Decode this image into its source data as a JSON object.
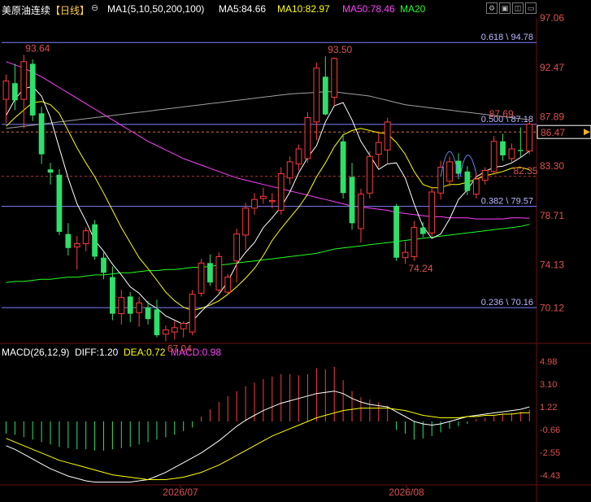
{
  "header": {
    "instrument": "美原油连续",
    "period_tag": "【日线】",
    "indicator_name": "MA1(5,10,50,200,100)",
    "ma5": "MA5:84.66",
    "ma10": "MA10:82.97",
    "ma50": "MA50:78.46",
    "ma20": "MA20",
    "colors": {
      "ma5": "#ffffff",
      "ma10": "#ffff00",
      "ma50": "#ff40ff",
      "ma20": "#20ff20"
    }
  },
  "toolbar": {
    "icons": [
      "gear-icon",
      "layout-icon",
      "panel-icon",
      "expand-icon"
    ]
  },
  "macd_header": {
    "name": "MACD(26,12,9)",
    "diff": "DIFF:1.20",
    "dea": "DEA:0.72",
    "macd": "MACD:0.98"
  },
  "price_axis": {
    "ticks": [
      "97.06",
      "92.47",
      "87.89",
      "83.30",
      "78.71",
      "74.13",
      "70.12"
    ],
    "current": "86.47"
  },
  "macd_axis": {
    "ticks": [
      "4.98",
      "3.10",
      "1.22",
      "-0.66",
      "-2.55",
      "-4.43"
    ]
  },
  "fib_levels": [
    {
      "ratio_label": "0.618 \\ 94.78",
      "price": 94.78
    },
    {
      "ratio_label": "0.500 \\ 87.18",
      "price": 87.18
    },
    {
      "ratio_label": "0.382 \\ 79.57",
      "price": 79.57
    },
    {
      "ratio_label": "0.236 \\ 70.16",
      "price": 70.16
    }
  ],
  "annotations": {
    "high1": "93.64",
    "high2": "93.50",
    "low1": "67.04",
    "low2": "74.24",
    "ref1": "87.69",
    "ref2": "82.35"
  },
  "x_axis": {
    "labels": [
      "2026/07",
      "2026/08"
    ]
  },
  "chart_data": {
    "type": "candlestick",
    "y_range": [
      67.0,
      97.06
    ],
    "candles": [
      {
        "o": 89.5,
        "h": 91.8,
        "l": 87.3,
        "c": 91.2
      },
      {
        "o": 91.0,
        "h": 92.8,
        "l": 88.5,
        "c": 89.4
      },
      {
        "o": 89.5,
        "h": 93.64,
        "l": 86.8,
        "c": 93.0
      },
      {
        "o": 92.8,
        "h": 93.2,
        "l": 87.5,
        "c": 88.0
      },
      {
        "o": 88.2,
        "h": 88.8,
        "l": 83.5,
        "c": 84.4
      },
      {
        "o": 83.0,
        "h": 83.6,
        "l": 81.6,
        "c": 82.7
      },
      {
        "o": 82.5,
        "h": 83.0,
        "l": 76.9,
        "c": 77.2
      },
      {
        "o": 77.0,
        "h": 78.0,
        "l": 75.0,
        "c": 75.7
      },
      {
        "o": 75.8,
        "h": 76.8,
        "l": 73.7,
        "c": 76.1
      },
      {
        "o": 76.1,
        "h": 77.6,
        "l": 75.4,
        "c": 77.3
      },
      {
        "o": 77.9,
        "h": 78.3,
        "l": 74.6,
        "c": 74.9
      },
      {
        "o": 74.8,
        "h": 75.3,
        "l": 72.8,
        "c": 73.4
      },
      {
        "o": 73.0,
        "h": 74.0,
        "l": 69.0,
        "c": 69.6
      },
      {
        "o": 69.6,
        "h": 71.8,
        "l": 68.6,
        "c": 71.1
      },
      {
        "o": 71.2,
        "h": 71.6,
        "l": 68.8,
        "c": 69.6
      },
      {
        "o": 69.7,
        "h": 71.2,
        "l": 68.4,
        "c": 70.6
      },
      {
        "o": 70.2,
        "h": 70.8,
        "l": 68.6,
        "c": 69.1
      },
      {
        "o": 70.0,
        "h": 70.9,
        "l": 67.4,
        "c": 67.6
      },
      {
        "o": 67.7,
        "h": 68.5,
        "l": 67.04,
        "c": 68.1
      },
      {
        "o": 67.9,
        "h": 68.9,
        "l": 67.2,
        "c": 68.3
      },
      {
        "o": 68.2,
        "h": 68.9,
        "l": 67.4,
        "c": 68.7
      },
      {
        "o": 67.9,
        "h": 71.8,
        "l": 67.6,
        "c": 71.4
      },
      {
        "o": 71.5,
        "h": 74.7,
        "l": 71.2,
        "c": 74.3
      },
      {
        "o": 74.3,
        "h": 75.1,
        "l": 72.2,
        "c": 72.5
      },
      {
        "o": 71.8,
        "h": 75.3,
        "l": 71.4,
        "c": 74.9
      },
      {
        "o": 71.6,
        "h": 73.3,
        "l": 71.4,
        "c": 73.0
      },
      {
        "o": 74.5,
        "h": 77.5,
        "l": 72.5,
        "c": 77.0
      },
      {
        "o": 76.9,
        "h": 79.9,
        "l": 75.5,
        "c": 79.4
      },
      {
        "o": 79.4,
        "h": 80.8,
        "l": 78.8,
        "c": 80.2
      },
      {
        "o": 80.3,
        "h": 81.3,
        "l": 79.8,
        "c": 80.5
      },
      {
        "o": 80.0,
        "h": 80.8,
        "l": 79.4,
        "c": 80.1
      },
      {
        "o": 79.2,
        "h": 83.2,
        "l": 78.8,
        "c": 82.6
      },
      {
        "o": 82.2,
        "h": 84.2,
        "l": 81.6,
        "c": 83.7
      },
      {
        "o": 83.5,
        "h": 85.3,
        "l": 82.9,
        "c": 84.9
      },
      {
        "o": 84.0,
        "h": 88.3,
        "l": 83.6,
        "c": 87.8
      },
      {
        "o": 87.4,
        "h": 92.9,
        "l": 85.7,
        "c": 92.4
      },
      {
        "o": 91.6,
        "h": 93.5,
        "l": 88.0,
        "c": 88.1
      },
      {
        "o": 89.7,
        "h": 93.4,
        "l": 88.9,
        "c": 93.3
      },
      {
        "o": 85.6,
        "h": 86.3,
        "l": 80.3,
        "c": 80.8
      },
      {
        "o": 82.3,
        "h": 83.6,
        "l": 77.4,
        "c": 78.0
      },
      {
        "o": 77.5,
        "h": 81.2,
        "l": 76.2,
        "c": 80.7
      },
      {
        "o": 80.8,
        "h": 84.7,
        "l": 80.3,
        "c": 84.2
      },
      {
        "o": 84.4,
        "h": 86.5,
        "l": 83.2,
        "c": 85.5
      },
      {
        "o": 84.8,
        "h": 87.8,
        "l": 83.5,
        "c": 87.4
      },
      {
        "o": 79.6,
        "h": 79.8,
        "l": 74.5,
        "c": 74.8
      },
      {
        "o": 74.8,
        "h": 76.3,
        "l": 74.24,
        "c": 75.3
      },
      {
        "o": 74.9,
        "h": 78.2,
        "l": 74.5,
        "c": 77.6
      },
      {
        "o": 77.6,
        "h": 78.1,
        "l": 76.7,
        "c": 77.0
      },
      {
        "o": 77.1,
        "h": 81.4,
        "l": 76.8,
        "c": 80.9
      },
      {
        "o": 80.8,
        "h": 83.8,
        "l": 80.2,
        "c": 83.2
      },
      {
        "o": 81.9,
        "h": 84.2,
        "l": 81.4,
        "c": 83.7
      },
      {
        "o": 83.8,
        "h": 84.5,
        "l": 82.1,
        "c": 82.6
      },
      {
        "o": 82.8,
        "h": 83.3,
        "l": 80.6,
        "c": 81.0
      },
      {
        "o": 80.7,
        "h": 82.6,
        "l": 80.3,
        "c": 82.1
      },
      {
        "o": 82.0,
        "h": 83.2,
        "l": 81.6,
        "c": 82.9
      },
      {
        "o": 82.8,
        "h": 86.1,
        "l": 82.5,
        "c": 85.6
      },
      {
        "o": 85.6,
        "h": 86.3,
        "l": 83.8,
        "c": 84.3
      },
      {
        "o": 84.0,
        "h": 85.4,
        "l": 83.7,
        "c": 84.9
      },
      {
        "o": 84.8,
        "h": 86.9,
        "l": 84.1,
        "c": 84.7
      },
      {
        "o": 84.7,
        "h": 87.69,
        "l": 84.4,
        "c": 87.2
      }
    ],
    "ma": {
      "ma5": [
        88.0,
        89.5,
        90.5,
        90.7,
        89.8,
        87.8,
        85.0,
        82.2,
        79.8,
        78.2,
        76.4,
        75.4,
        74.2,
        73.2,
        72.1,
        71.5,
        70.6,
        70.1,
        69.4,
        69.0,
        68.6,
        68.9,
        69.8,
        70.6,
        71.4,
        72.6,
        74.2,
        75.3,
        76.2,
        77.6,
        78.5,
        79.5,
        80.9,
        82.7,
        84.1,
        85.2,
        87.4,
        88.9,
        89.2,
        87.6,
        85.6,
        84.3,
        83.0,
        83.5,
        83.6,
        82.2,
        79.8,
        77.7,
        76.6,
        77.0,
        78.4,
        80.2,
        81.1,
        82.3,
        82.8,
        83.2,
        83.3,
        83.6,
        84.1,
        84.7
      ],
      "ma10": [
        87.0,
        87.8,
        88.5,
        89.2,
        89.3,
        89.0,
        88.2,
        86.6,
        85.0,
        83.6,
        82.3,
        80.8,
        79.2,
        77.6,
        76.2,
        74.8,
        73.8,
        72.7,
        71.6,
        70.8,
        70.2,
        69.9,
        70.1,
        70.4,
        70.8,
        71.4,
        72.1,
        72.9,
        73.8,
        75.0,
        76.4,
        77.5,
        78.5,
        79.5,
        80.7,
        82.3,
        83.6,
        85.1,
        86.2,
        86.6,
        86.8,
        86.6,
        86.4,
        86.3,
        85.5,
        84.4,
        82.8,
        81.6,
        81.3,
        81.3,
        81.6,
        81.6,
        81.8,
        82.1,
        82.4,
        82.6,
        82.8,
        83.1,
        83.2,
        82.97
      ],
      "ma50": [
        93.0,
        92.7,
        92.4,
        92.0,
        91.6,
        91.1,
        90.6,
        90.1,
        89.6,
        89.1,
        88.6,
        88.1,
        87.6,
        87.1,
        86.6,
        86.1,
        85.6,
        85.2,
        84.8,
        84.4,
        84.0,
        83.7,
        83.4,
        83.1,
        82.8,
        82.5,
        82.2,
        82.0,
        81.8,
        81.6,
        81.4,
        81.2,
        81.0,
        80.8,
        80.6,
        80.4,
        80.2,
        80.0,
        79.8,
        79.6,
        79.5,
        79.4,
        79.3,
        79.2,
        79.0,
        78.9,
        78.8,
        78.7,
        78.6,
        78.6,
        78.5,
        78.5,
        78.5,
        78.4,
        78.4,
        78.4,
        78.4,
        78.5,
        78.5,
        78.46
      ],
      "ma20": [
        72.5,
        72.6,
        72.6,
        72.7,
        72.8,
        72.8,
        72.9,
        73.0,
        73.0,
        73.1,
        73.2,
        73.2,
        73.3,
        73.4,
        73.4,
        73.5,
        73.6,
        73.6,
        73.7,
        73.7,
        73.8,
        73.9,
        73.9,
        74.0,
        74.1,
        74.2,
        74.3,
        74.4,
        74.5,
        74.6,
        74.7,
        74.8,
        74.9,
        75.0,
        75.1,
        75.2,
        75.4,
        75.6,
        75.7,
        75.8,
        75.9,
        76.0,
        76.1,
        76.2,
        76.3,
        76.4,
        76.5,
        76.6,
        76.7,
        76.8,
        76.9,
        77.0,
        77.1,
        77.2,
        77.3,
        77.4,
        77.5,
        77.6,
        77.7,
        77.9
      ],
      "ma200": [
        86.8,
        86.9,
        87.0,
        87.1,
        87.2,
        87.3,
        87.4,
        87.5,
        87.6,
        87.7,
        87.8,
        87.9,
        88.0,
        88.1,
        88.2,
        88.3,
        88.4,
        88.5,
        88.6,
        88.7,
        88.8,
        88.9,
        89.0,
        89.1,
        89.2,
        89.3,
        89.4,
        89.5,
        89.6,
        89.7,
        89.8,
        89.9,
        90.0,
        90.05,
        90.1,
        90.15,
        90.2,
        90.2,
        90.1,
        90.0,
        89.9,
        89.8,
        89.6,
        89.4,
        89.2,
        89.0,
        88.9,
        88.8,
        88.7,
        88.6,
        88.5,
        88.4,
        88.3,
        88.2,
        88.1,
        88.0,
        87.9,
        87.8,
        87.7,
        87.6
      ]
    },
    "macd": {
      "y_range": [
        -5.1,
        5.5
      ],
      "hist": [
        -1.0,
        -1.1,
        -1.3,
        -1.5,
        -1.7,
        -1.9,
        -2.1,
        -2.2,
        -2.3,
        -2.3,
        -2.4,
        -2.4,
        -2.3,
        -2.2,
        -2.1,
        -1.9,
        -1.7,
        -1.5,
        -1.3,
        -1.1,
        -0.8,
        -0.5,
        0.4,
        1.0,
        1.6,
        2.1,
        2.5,
        2.9,
        3.2,
        3.5,
        3.7,
        3.9,
        3.9,
        3.8,
        3.9,
        4.4,
        4.3,
        4.5,
        3.4,
        2.5,
        2.0,
        1.8,
        1.6,
        1.3,
        -0.7,
        -1.0,
        -1.5,
        -1.4,
        -1.2,
        -0.9,
        -0.6,
        -0.4,
        -0.2,
        0.2,
        0.3,
        0.5,
        0.6,
        0.7,
        0.8,
        0.98
      ],
      "diff": [
        -2.0,
        -2.3,
        -2.7,
        -3.1,
        -3.5,
        -3.9,
        -4.2,
        -4.5,
        -4.7,
        -4.9,
        -5.0,
        -5.0,
        -5.0,
        -5.0,
        -5.0,
        -4.9,
        -4.8,
        -4.5,
        -4.2,
        -3.8,
        -3.4,
        -3.0,
        -2.6,
        -2.1,
        -1.6,
        -1.0,
        -0.4,
        0.1,
        0.5,
        0.9,
        1.2,
        1.5,
        1.7,
        1.9,
        2.1,
        2.3,
        2.4,
        2.5,
        2.3,
        1.9,
        1.6,
        1.4,
        1.3,
        1.2,
        0.8,
        0.4,
        0.0,
        -0.2,
        -0.3,
        -0.2,
        0.0,
        0.2,
        0.4,
        0.5,
        0.6,
        0.7,
        0.8,
        0.9,
        1.0,
        1.2
      ],
      "dea": [
        -1.4,
        -1.7,
        -2.0,
        -2.3,
        -2.6,
        -2.9,
        -3.2,
        -3.4,
        -3.6,
        -3.8,
        -4.0,
        -4.2,
        -4.4,
        -4.5,
        -4.6,
        -4.7,
        -4.8,
        -4.8,
        -4.8,
        -4.7,
        -4.6,
        -4.4,
        -4.2,
        -3.9,
        -3.6,
        -3.2,
        -2.8,
        -2.4,
        -2.0,
        -1.6,
        -1.2,
        -0.9,
        -0.6,
        -0.3,
        0.0,
        0.3,
        0.5,
        0.7,
        0.9,
        1.0,
        1.1,
        1.1,
        1.1,
        1.1,
        1.0,
        0.9,
        0.7,
        0.5,
        0.4,
        0.3,
        0.3,
        0.3,
        0.4,
        0.4,
        0.5,
        0.5,
        0.6,
        0.6,
        0.7,
        0.72
      ]
    }
  }
}
